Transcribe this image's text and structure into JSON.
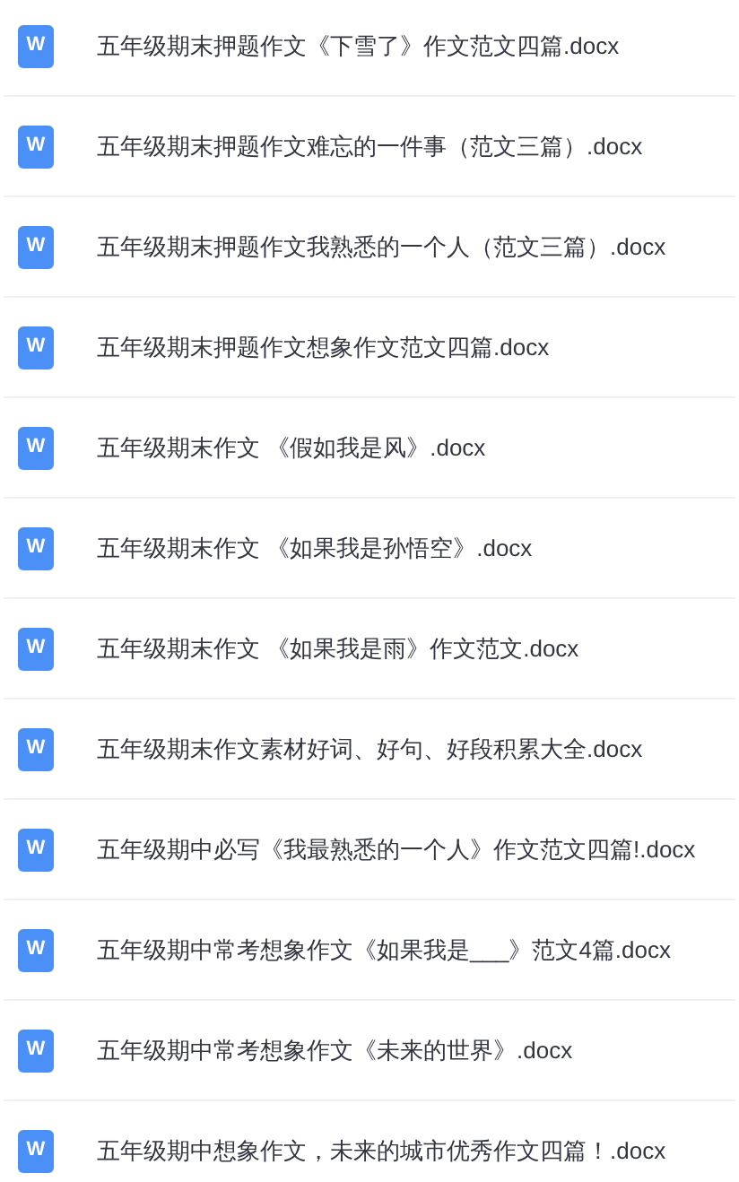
{
  "files": [
    {
      "icon_letter": "W",
      "name": "五年级期末押题作文《下雪了》作文范文四篇.docx"
    },
    {
      "icon_letter": "W",
      "name": "五年级期末押题作文难忘的一件事（范文三篇）.docx"
    },
    {
      "icon_letter": "W",
      "name": "五年级期末押题作文我熟悉的一个人（范文三篇）.docx"
    },
    {
      "icon_letter": "W",
      "name": "五年级期末押题作文想象作文范文四篇.docx"
    },
    {
      "icon_letter": "W",
      "name": "五年级期末作文 《假如我是风》.docx"
    },
    {
      "icon_letter": "W",
      "name": "五年级期末作文 《如果我是孙悟空》.docx"
    },
    {
      "icon_letter": "W",
      "name": "五年级期末作文 《如果我是雨》作文范文.docx"
    },
    {
      "icon_letter": "W",
      "name": "五年级期末作文素材好词、好句、好段积累大全.docx"
    },
    {
      "icon_letter": "W",
      "name": "五年级期中必写《我最熟悉的一个人》作文范文四篇!.docx"
    },
    {
      "icon_letter": "W",
      "name": "五年级期中常考想象作文《如果我是___》范文4篇.docx"
    },
    {
      "icon_letter": "W",
      "name": "五年级期中常考想象作文《未来的世界》.docx"
    },
    {
      "icon_letter": "W",
      "name": "五年级期中想象作文，未来的城市优秀作文四篇！.docx"
    }
  ]
}
